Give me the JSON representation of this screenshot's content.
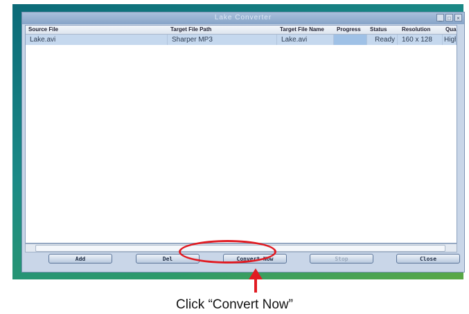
{
  "window": {
    "title": "Lake Converter"
  },
  "window_controls": [
    "minimize-icon",
    "maximize-icon",
    "close-icon"
  ],
  "table": {
    "headers": [
      "Source File",
      "Target File Path",
      "Target File Name",
      "Progress",
      "Status",
      "Resolution",
      "Qua"
    ],
    "rows": [
      {
        "source": "Lake.avi",
        "target_path": "Sharper MP3",
        "target_name": "Lake.avi",
        "progress": "",
        "status": "Ready",
        "resolution": "160 x 128",
        "quality": "High"
      }
    ]
  },
  "buttons": {
    "add": "Add",
    "del": "Del",
    "convert": "Convert Now",
    "stop": "Stop",
    "close": "Close"
  },
  "caption": "Click “Convert Now”",
  "colors": {
    "annotation": "#e11b22",
    "selected_row": "#c5d8ee"
  }
}
